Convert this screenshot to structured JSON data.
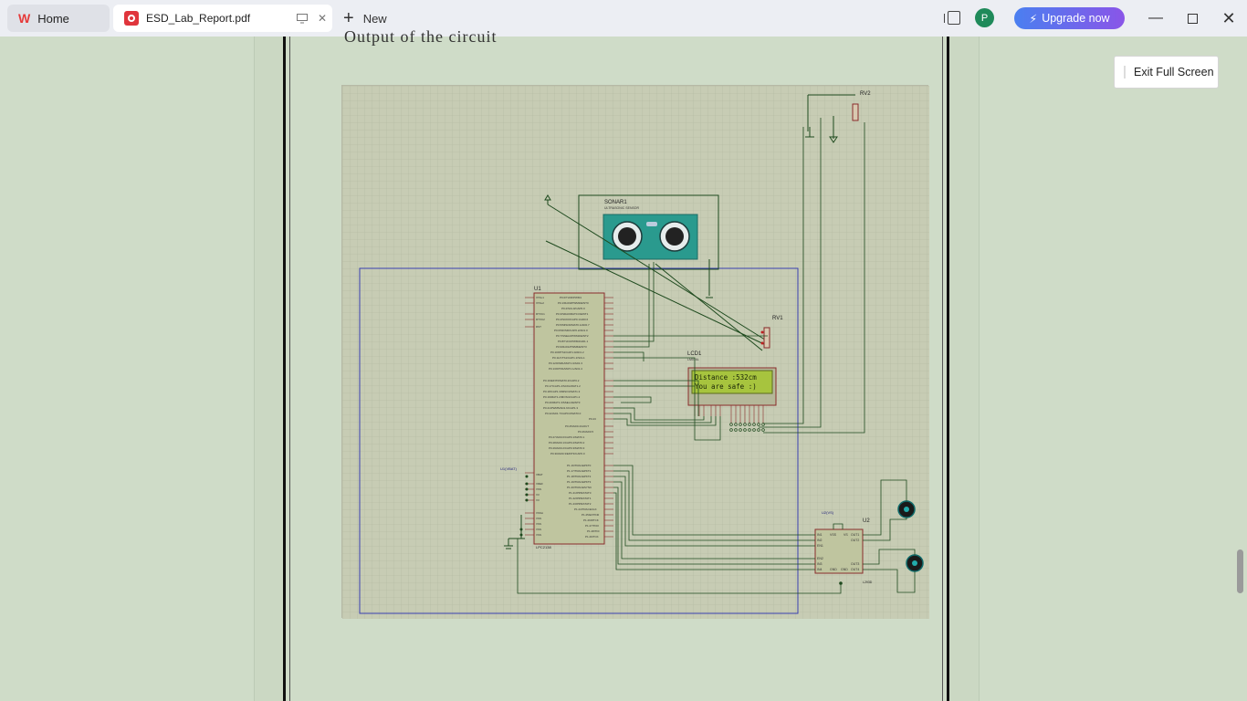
{
  "tabs": {
    "home_label": "Home",
    "doc_label": "ESD_Lab_Report.pdf",
    "new_label": "New"
  },
  "account": {
    "avatar_letter": "P",
    "upgrade_label": "Upgrade now"
  },
  "viewer": {
    "exit_fullscreen_label": "Exit Full Screen",
    "cut_text": "Output of the circuit"
  },
  "schematic": {
    "rv2_label": "RV2",
    "sonar_label": "SONAR1",
    "sonar_sub": "ULTRASONIC SENSOR",
    "u1_label": "U1",
    "u1_part": "LPC2138",
    "rv1_label": "RV1",
    "lcd_label": "LCD1",
    "lcd_part": "LM016L",
    "lcd_line1": "Distance :532cm",
    "lcd_line2": "You are safe :)",
    "u2_label": "U2",
    "u2_part": "L293D",
    "u1_vbat": "U1(VBAT)",
    "u2_vs": "U2(VS)"
  },
  "colors": {
    "brand_red": "#e63b3b",
    "upgrade_start": "#4a7ff0",
    "upgrade_end": "#8a55e8",
    "avatar_green": "#1f8a5a",
    "lcd_bg": "#a7c43e"
  }
}
